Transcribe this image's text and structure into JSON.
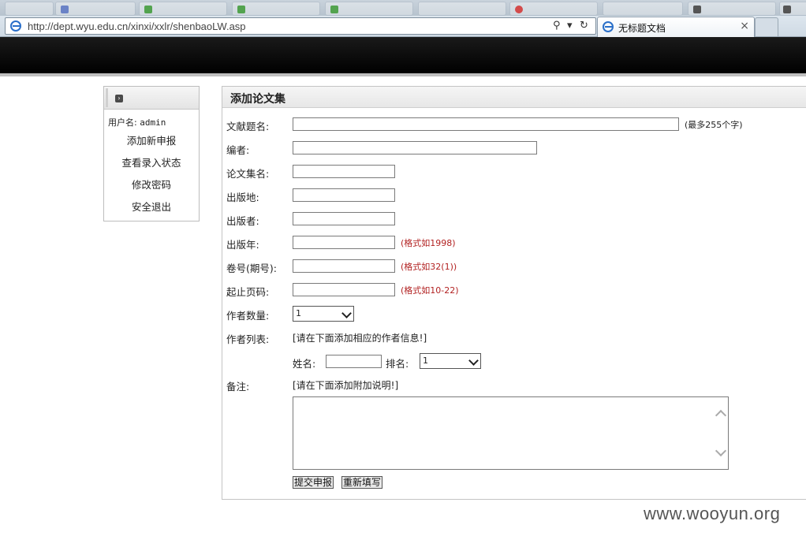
{
  "browser": {
    "url": "http://dept.wyu.edu.cn/xinxi/xxlr/shenbaoLW.asp",
    "tab_title": "无标题文档",
    "tab_close": "×",
    "search_glyph": "⚲",
    "dropdown_glyph": "▾",
    "refresh_glyph": "↻"
  },
  "sidebar": {
    "user_label": "用户名:",
    "user_value": "admin",
    "items": [
      {
        "label": "添加新申报"
      },
      {
        "label": "查看录入状态"
      },
      {
        "label": "修改密码"
      },
      {
        "label": "安全退出"
      }
    ]
  },
  "form": {
    "title": "添加论文集",
    "fields": {
      "doc_name": {
        "label": "文献题名:",
        "hint": "(最多255个字)"
      },
      "editor": {
        "label": "编者:"
      },
      "collection": {
        "label": "论文集名:"
      },
      "place": {
        "label": "出版地:"
      },
      "publisher": {
        "label": "出版者:"
      },
      "year": {
        "label": "出版年:",
        "hint": "(格式如1998)"
      },
      "volume": {
        "label": "卷号(期号):",
        "hint": "(格式如32(1))"
      },
      "pages": {
        "label": "起止页码:",
        "hint": "(格式如10-22)"
      },
      "author_count": {
        "label": "作者数量:",
        "value": "1"
      },
      "author_list": {
        "label": "作者列表:",
        "hint": "[请在下面添加相应的作者信息!]"
      },
      "author_name": {
        "label": "姓名:"
      },
      "author_rank": {
        "label": "排名:",
        "value": "1"
      },
      "remark": {
        "label": "备注:",
        "hint": "[请在下面添加附加说明!]"
      }
    },
    "buttons": {
      "submit": "提交申报",
      "reset": "重新填写"
    }
  },
  "watermark": "www.wooyun.org",
  "colors": {
    "hint_red": "#b22222",
    "header_bar": "#000000"
  }
}
